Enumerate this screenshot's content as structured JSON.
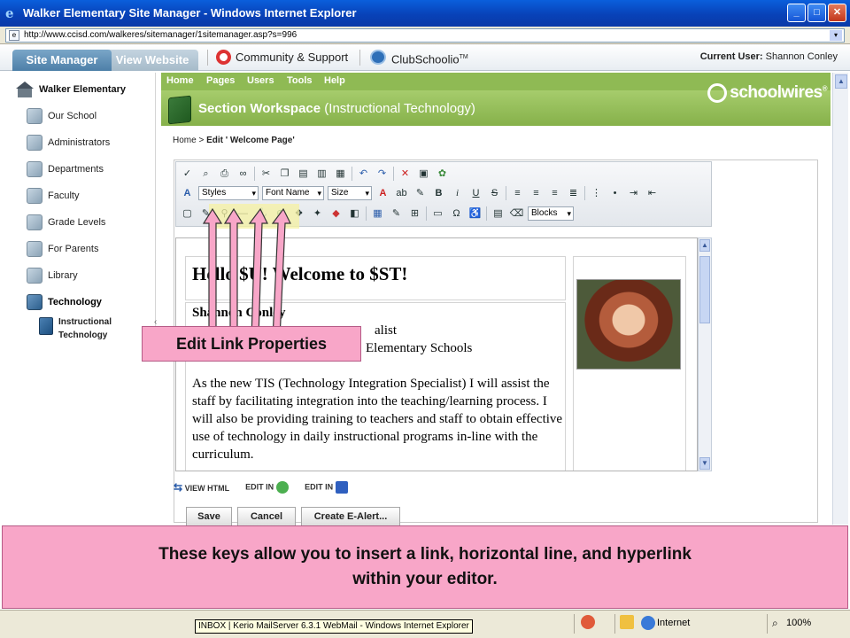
{
  "window": {
    "title": "Walker Elementary Site Manager - Windows Internet Explorer"
  },
  "address": {
    "url": "http://www.ccisd.com/walkeres/sitemanager/1sitemanager.asp?s=996"
  },
  "topbar": {
    "tab_site_manager": "Site Manager",
    "tab_view_website": "View Website",
    "community": "Community & Support",
    "clubschoolio": "ClubSchoolio",
    "clubschoolio_tm": "TM",
    "current_user_label": "Current User:",
    "current_user_name": "Shannon Conley"
  },
  "sidebar": {
    "school": "Walker Elementary",
    "items": [
      {
        "label": "Our School"
      },
      {
        "label": "Administrators"
      },
      {
        "label": "Departments"
      },
      {
        "label": "Faculty"
      },
      {
        "label": "Grade Levels"
      },
      {
        "label": "For Parents"
      },
      {
        "label": "Library"
      },
      {
        "label": "Technology"
      }
    ],
    "sub_item": "Instructional Technology"
  },
  "menu": {
    "home": "Home",
    "pages": "Pages",
    "users": "Users",
    "tools": "Tools",
    "help": "Help"
  },
  "workspace": {
    "title": "Section Workspace",
    "subtitle": "(Instructional Technology)",
    "logo": "schoolwires",
    "logo_mark": "®"
  },
  "breadcrumb": {
    "home": "Home",
    "sep": ">",
    "current": "Edit ' Welcome Page'"
  },
  "editor": {
    "styles": "Styles",
    "font_name": "Font Name",
    "size": "Size",
    "blocks": "Blocks",
    "mode_view_html": "VIEW HTML",
    "mode_edit_in_1": "EDIT IN",
    "mode_edit_in_2": "EDIT IN"
  },
  "content": {
    "heading": "Hello $U! Welcome to $ST!",
    "name": "Shannon Conley",
    "role": "alist",
    "schools": "Elementary Schools",
    "paragraph": "As the new TIS (Technology Integration Specialist) I will assist the staff by facilitating integration into the teaching/learning process. I will also be providing training to teachers and staff to obtain effective use of technology in daily instructional programs in-line with the curriculum."
  },
  "buttons": {
    "save": "Save",
    "cancel": "Cancel",
    "create_alert": "Create E-Alert..."
  },
  "callout": {
    "label": "Edit Link Properties"
  },
  "caption": {
    "line1": "These keys allow you to insert a link, horizontal line, and hyperlink",
    "line2": "within your editor."
  },
  "statusbar": {
    "taskbar_tip": "INBOX | Kerio MailServer 6.3.1 WebMail - Windows Internet Explorer",
    "zone": "Internet",
    "zoom": "100%"
  },
  "colors": {
    "callout_pink": "#f8a6c8",
    "green_header": "#8fba54",
    "xp_blue": "#0a5fdc"
  }
}
